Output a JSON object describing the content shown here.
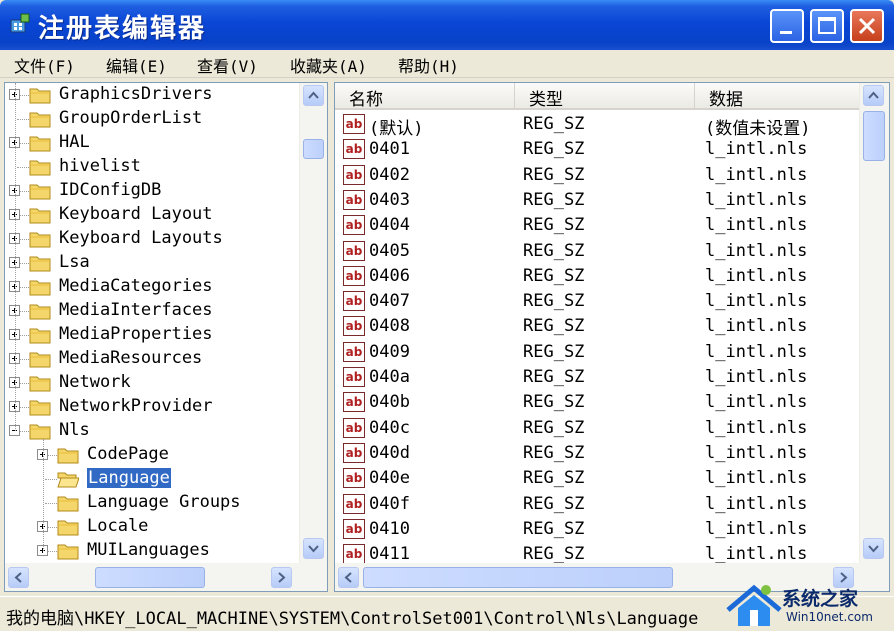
{
  "window": {
    "title": "注册表编辑器"
  },
  "menu": [
    "文件(F)",
    "编辑(E)",
    "查看(V)",
    "收藏夹(A)",
    "帮助(H)"
  ],
  "tree": {
    "items": [
      {
        "label": "GraphicsDrivers",
        "level": 0,
        "expandable": true,
        "expanded": false,
        "selected": false
      },
      {
        "label": "GroupOrderList",
        "level": 0,
        "expandable": false,
        "expanded": false,
        "selected": false
      },
      {
        "label": "HAL",
        "level": 0,
        "expandable": true,
        "expanded": false,
        "selected": false
      },
      {
        "label": "hivelist",
        "level": 0,
        "expandable": false,
        "expanded": false,
        "selected": false
      },
      {
        "label": "IDConfigDB",
        "level": 0,
        "expandable": true,
        "expanded": false,
        "selected": false
      },
      {
        "label": "Keyboard Layout",
        "level": 0,
        "expandable": true,
        "expanded": false,
        "selected": false
      },
      {
        "label": "Keyboard Layouts",
        "level": 0,
        "expandable": true,
        "expanded": false,
        "selected": false
      },
      {
        "label": "Lsa",
        "level": 0,
        "expandable": true,
        "expanded": false,
        "selected": false
      },
      {
        "label": "MediaCategories",
        "level": 0,
        "expandable": true,
        "expanded": false,
        "selected": false
      },
      {
        "label": "MediaInterfaces",
        "level": 0,
        "expandable": true,
        "expanded": false,
        "selected": false
      },
      {
        "label": "MediaProperties",
        "level": 0,
        "expandable": true,
        "expanded": false,
        "selected": false
      },
      {
        "label": "MediaResources",
        "level": 0,
        "expandable": true,
        "expanded": false,
        "selected": false
      },
      {
        "label": "Network",
        "level": 0,
        "expandable": true,
        "expanded": false,
        "selected": false
      },
      {
        "label": "NetworkProvider",
        "level": 0,
        "expandable": true,
        "expanded": false,
        "selected": false
      },
      {
        "label": "Nls",
        "level": 0,
        "expandable": true,
        "expanded": true,
        "selected": false
      },
      {
        "label": "CodePage",
        "level": 1,
        "expandable": true,
        "expanded": false,
        "selected": false
      },
      {
        "label": "Language",
        "level": 1,
        "expandable": false,
        "expanded": false,
        "selected": true
      },
      {
        "label": "Language Groups",
        "level": 1,
        "expandable": false,
        "expanded": false,
        "selected": false
      },
      {
        "label": "Locale",
        "level": 1,
        "expandable": true,
        "expanded": false,
        "selected": false
      },
      {
        "label": "MUILanguages",
        "level": 1,
        "expandable": true,
        "expanded": false,
        "selected": false
      }
    ]
  },
  "list": {
    "columns": [
      "名称",
      "类型",
      "数据"
    ],
    "rows": [
      {
        "name": "(默认)",
        "type": "REG_SZ",
        "data": "(数值未设置)"
      },
      {
        "name": "0401",
        "type": "REG_SZ",
        "data": "l_intl.nls"
      },
      {
        "name": "0402",
        "type": "REG_SZ",
        "data": "l_intl.nls"
      },
      {
        "name": "0403",
        "type": "REG_SZ",
        "data": "l_intl.nls"
      },
      {
        "name": "0404",
        "type": "REG_SZ",
        "data": "l_intl.nls"
      },
      {
        "name": "0405",
        "type": "REG_SZ",
        "data": "l_intl.nls"
      },
      {
        "name": "0406",
        "type": "REG_SZ",
        "data": "l_intl.nls"
      },
      {
        "name": "0407",
        "type": "REG_SZ",
        "data": "l_intl.nls"
      },
      {
        "name": "0408",
        "type": "REG_SZ",
        "data": "l_intl.nls"
      },
      {
        "name": "0409",
        "type": "REG_SZ",
        "data": "l_intl.nls"
      },
      {
        "name": "040a",
        "type": "REG_SZ",
        "data": "l_intl.nls"
      },
      {
        "name": "040b",
        "type": "REG_SZ",
        "data": "l_intl.nls"
      },
      {
        "name": "040c",
        "type": "REG_SZ",
        "data": "l_intl.nls"
      },
      {
        "name": "040d",
        "type": "REG_SZ",
        "data": "l_intl.nls"
      },
      {
        "name": "040e",
        "type": "REG_SZ",
        "data": "l_intl.nls"
      },
      {
        "name": "040f",
        "type": "REG_SZ",
        "data": "l_intl.nls"
      },
      {
        "name": "0410",
        "type": "REG_SZ",
        "data": "l_intl.nls"
      },
      {
        "name": "0411",
        "type": "REG_SZ",
        "data": "l_intl.nls"
      }
    ],
    "value_icon": "ab"
  },
  "status": {
    "path": "我的电脑\\HKEY_LOCAL_MACHINE\\SYSTEM\\ControlSet001\\Control\\Nls\\Language"
  },
  "watermark": {
    "title": "系统之家",
    "subtitle": "Win10net.com"
  },
  "colors": {
    "titlebar": "#0842c8",
    "selection": "#316ac5",
    "menu_bg": "#ece9d8",
    "icon_red": "#b02020",
    "folder": "#f5d66b"
  }
}
